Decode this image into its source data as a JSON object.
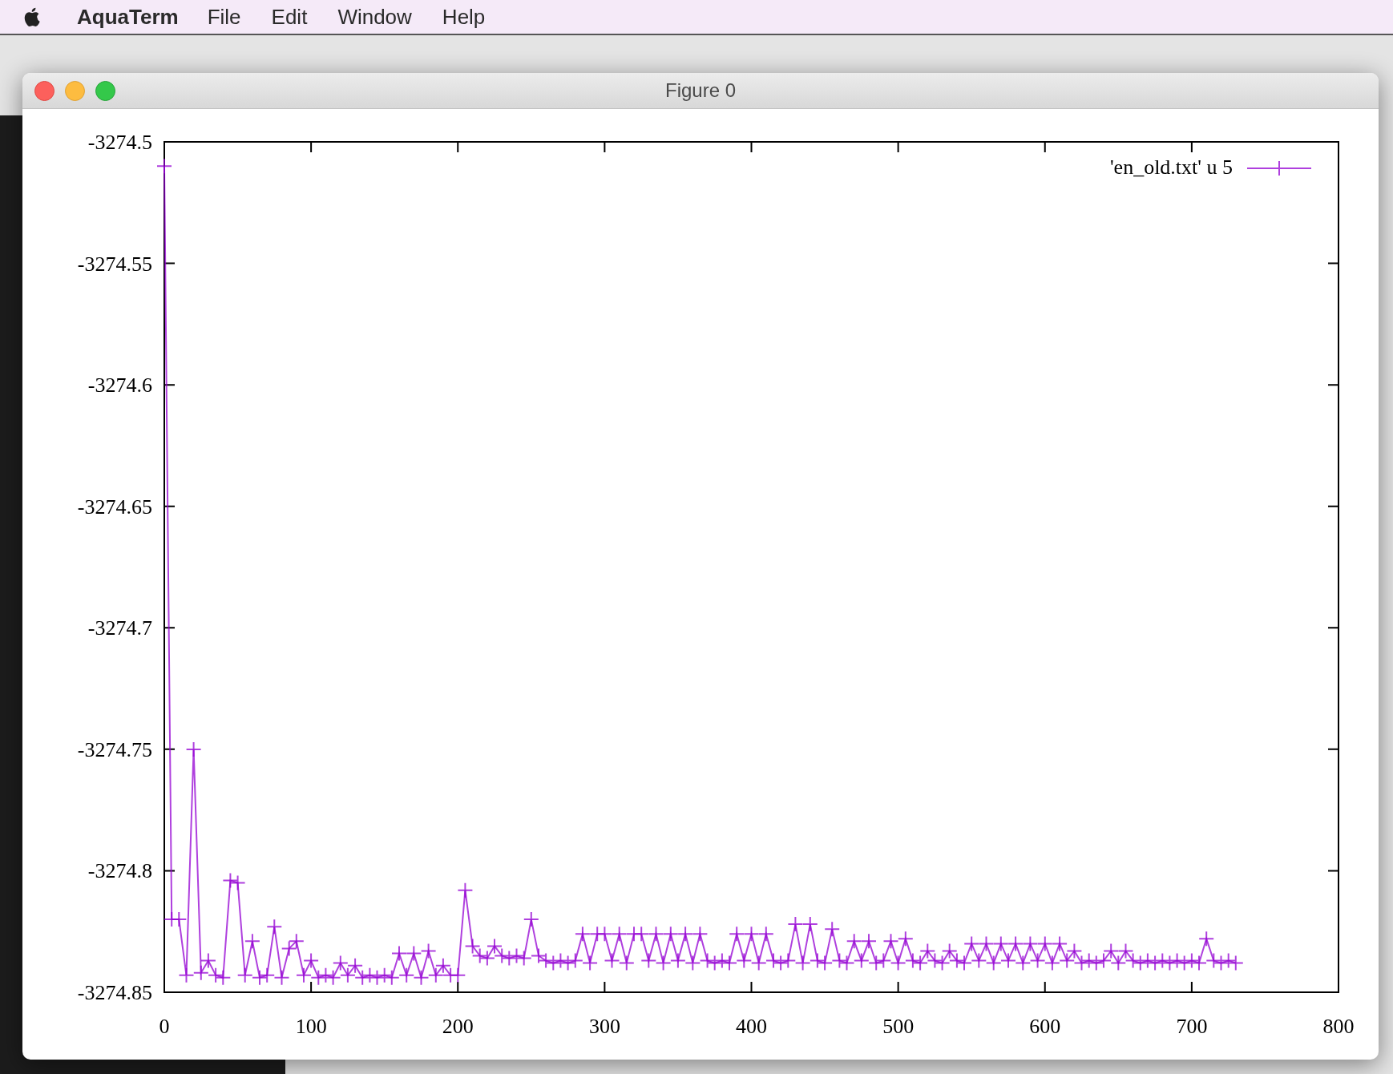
{
  "menu_bar": {
    "app_name": "AquaTerm",
    "items": [
      "File",
      "Edit",
      "Window",
      "Help"
    ]
  },
  "window": {
    "title": "Figure 0"
  },
  "chart_data": {
    "type": "line",
    "xlim": [
      0,
      800
    ],
    "ylim": [
      -3274.85,
      -3274.5
    ],
    "xticks": [
      0,
      100,
      200,
      300,
      400,
      500,
      600,
      700,
      800
    ],
    "yticks": [
      {
        "value": -3274.5,
        "label": "-3274.5"
      },
      {
        "value": -3274.55,
        "label": "-3274.55"
      },
      {
        "value": -3274.6,
        "label": "-3274.6"
      },
      {
        "value": -3274.65,
        "label": "-3274.65"
      },
      {
        "value": -3274.7,
        "label": "-3274.7"
      },
      {
        "value": -3274.75,
        "label": "-3274.75"
      },
      {
        "value": -3274.8,
        "label": "-3274.8"
      },
      {
        "value": -3274.85,
        "label": "-3274.85"
      }
    ],
    "x": [
      0,
      5,
      10,
      15,
      20,
      25,
      30,
      35,
      40,
      45,
      50,
      55,
      60,
      65,
      70,
      75,
      80,
      85,
      90,
      95,
      100,
      105,
      110,
      115,
      120,
      125,
      130,
      135,
      140,
      145,
      150,
      155,
      160,
      165,
      170,
      175,
      180,
      185,
      190,
      195,
      200,
      205,
      210,
      215,
      220,
      225,
      230,
      235,
      240,
      245,
      250,
      255,
      260,
      265,
      270,
      275,
      280,
      285,
      290,
      295,
      300,
      305,
      310,
      315,
      320,
      325,
      330,
      335,
      340,
      345,
      350,
      355,
      360,
      365,
      370,
      375,
      380,
      385,
      390,
      395,
      400,
      405,
      410,
      415,
      420,
      425,
      430,
      435,
      440,
      445,
      450,
      455,
      460,
      465,
      470,
      475,
      480,
      485,
      490,
      495,
      500,
      505,
      510,
      515,
      520,
      525,
      530,
      535,
      540,
      545,
      550,
      555,
      560,
      565,
      570,
      575,
      580,
      585,
      590,
      595,
      600,
      605,
      610,
      615,
      620,
      625,
      630,
      635,
      640,
      645,
      650,
      655,
      660,
      665,
      670,
      675,
      680,
      685,
      690,
      695,
      700,
      705,
      710,
      715,
      720,
      725,
      730
    ],
    "series": [
      {
        "name": "'en_old.txt' u 5",
        "color": "#9400d3",
        "marker": "plus",
        "values": [
          -3274.51,
          -3274.82,
          -3274.82,
          -3274.843,
          -3274.75,
          -3274.842,
          -3274.837,
          -3274.843,
          -3274.844,
          -3274.804,
          -3274.805,
          -3274.843,
          -3274.829,
          -3274.844,
          -3274.843,
          -3274.823,
          -3274.844,
          -3274.832,
          -3274.829,
          -3274.843,
          -3274.837,
          -3274.844,
          -3274.843,
          -3274.844,
          -3274.838,
          -3274.843,
          -3274.839,
          -3274.844,
          -3274.843,
          -3274.844,
          -3274.843,
          -3274.844,
          -3274.834,
          -3274.843,
          -3274.834,
          -3274.844,
          -3274.833,
          -3274.843,
          -3274.839,
          -3274.843,
          -3274.843,
          -3274.808,
          -3274.831,
          -3274.835,
          -3274.836,
          -3274.831,
          -3274.835,
          -3274.836,
          -3274.835,
          -3274.836,
          -3274.82,
          -3274.835,
          -3274.837,
          -3274.838,
          -3274.837,
          -3274.838,
          -3274.837,
          -3274.826,
          -3274.838,
          -3274.826,
          -3274.826,
          -3274.837,
          -3274.826,
          -3274.838,
          -3274.826,
          -3274.826,
          -3274.837,
          -3274.826,
          -3274.838,
          -3274.826,
          -3274.837,
          -3274.826,
          -3274.838,
          -3274.826,
          -3274.837,
          -3274.838,
          -3274.837,
          -3274.838,
          -3274.826,
          -3274.837,
          -3274.826,
          -3274.838,
          -3274.826,
          -3274.837,
          -3274.838,
          -3274.837,
          -3274.822,
          -3274.838,
          -3274.822,
          -3274.837,
          -3274.838,
          -3274.824,
          -3274.837,
          -3274.838,
          -3274.829,
          -3274.837,
          -3274.829,
          -3274.838,
          -3274.837,
          -3274.829,
          -3274.838,
          -3274.828,
          -3274.837,
          -3274.838,
          -3274.833,
          -3274.837,
          -3274.838,
          -3274.833,
          -3274.837,
          -3274.838,
          -3274.83,
          -3274.837,
          -3274.83,
          -3274.838,
          -3274.83,
          -3274.837,
          -3274.83,
          -3274.838,
          -3274.83,
          -3274.837,
          -3274.83,
          -3274.838,
          -3274.83,
          -3274.837,
          -3274.833,
          -3274.838,
          -3274.837,
          -3274.838,
          -3274.837,
          -3274.833,
          -3274.838,
          -3274.833,
          -3274.837,
          -3274.838,
          -3274.837,
          -3274.838,
          -3274.837,
          -3274.838,
          -3274.837,
          -3274.838,
          -3274.837,
          -3274.838,
          -3274.828,
          -3274.837,
          -3274.838,
          -3274.837,
          -3274.838
        ]
      }
    ]
  }
}
